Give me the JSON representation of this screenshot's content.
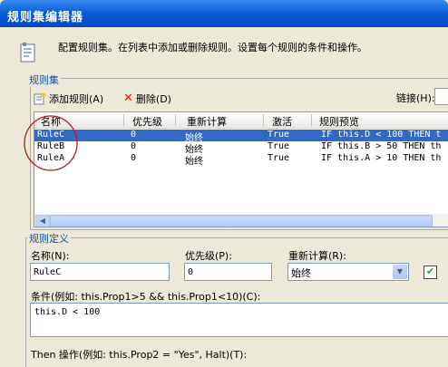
{
  "window": {
    "title": "规则集编辑器"
  },
  "description": "配置规则集。在列表中添加或删除规则。设置每个规则的条件和操作。",
  "rules_group": {
    "label": "规则集",
    "add_label": "添加规则(A)",
    "delete_label": "删除(D)",
    "link_label": "链接(H):",
    "columns": [
      "名称",
      "优先级",
      "重新计算",
      "激活",
      "规则预览"
    ],
    "rows": [
      {
        "name": "RuleC",
        "priority": "0",
        "reeval": "始终",
        "active": "True",
        "preview": "IF this.D < 100 THEN t"
      },
      {
        "name": "RuleB",
        "priority": "0",
        "reeval": "始终",
        "active": "True",
        "preview": "IF this.B > 50 THEN th"
      },
      {
        "name": "RuleA",
        "priority": "0",
        "reeval": "始终",
        "active": "True",
        "preview": "IF this.A > 10 THEN th"
      }
    ]
  },
  "definition_group": {
    "label": "规则定义",
    "name_label": "名称(N):",
    "name_value": "RuleC",
    "priority_label": "优先级(P):",
    "priority_value": "0",
    "reeval_label": "重新计算(R):",
    "reeval_value": "始终",
    "condition_label": "条件(例如: this.Prop1>5 && this.Prop1<10)(C):",
    "condition_value": "this.D < 100",
    "then_label": "Then 操作(例如: this.Prop2 = \"Yes\", Halt)(T):"
  },
  "colors": {
    "selection": "#316ac5",
    "titlebar": "#0a5fd8",
    "annotation": "#c0181a"
  }
}
